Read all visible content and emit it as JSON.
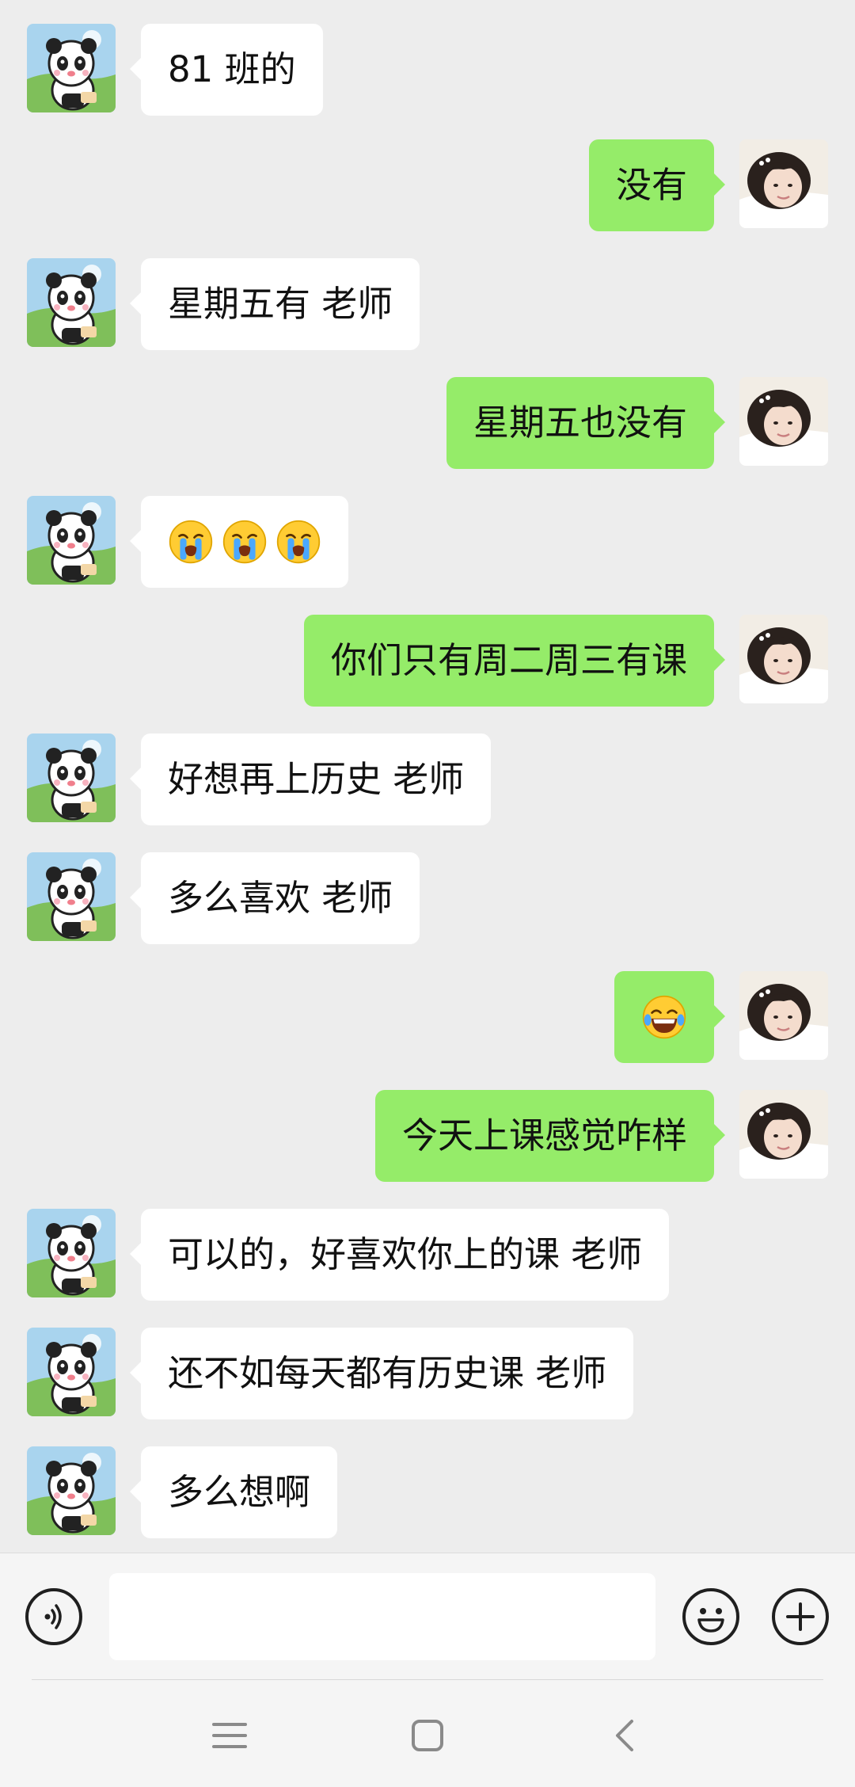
{
  "messages": [
    {
      "side": "left",
      "text": "81 班的"
    },
    {
      "side": "right",
      "text": "没有"
    },
    {
      "side": "left",
      "text": "星期五有 老师"
    },
    {
      "side": "right",
      "text": "星期五也没有"
    },
    {
      "side": "left",
      "emojis": [
        "crying-face",
        "crying-face",
        "crying-face"
      ]
    },
    {
      "side": "right",
      "text": "你们只有周二周三有课"
    },
    {
      "side": "left",
      "text": "好想再上历史 老师"
    },
    {
      "side": "left",
      "text": "多么喜欢 老师"
    },
    {
      "side": "right",
      "emojis": [
        "tears-of-joy-face"
      ]
    },
    {
      "side": "right",
      "text": "今天上课感觉咋样"
    },
    {
      "side": "left",
      "text": "可以的，好喜欢你上的课 老师"
    },
    {
      "side": "left",
      "text": "还不如每天都有历史课 老师"
    },
    {
      "side": "left",
      "text": "多么想啊"
    }
  ],
  "input_bar": {
    "voice_icon": "voice-icon",
    "emoji_icon": "emoji-icon",
    "plus_icon": "plus-icon",
    "input_value": ""
  },
  "nav_bar": {
    "menu_icon": "menu-icon",
    "home_icon": "home-icon",
    "back_icon": "back-icon"
  },
  "colors": {
    "background": "#ededed",
    "bubble_self": "#95ec69",
    "bubble_other": "#ffffff"
  }
}
